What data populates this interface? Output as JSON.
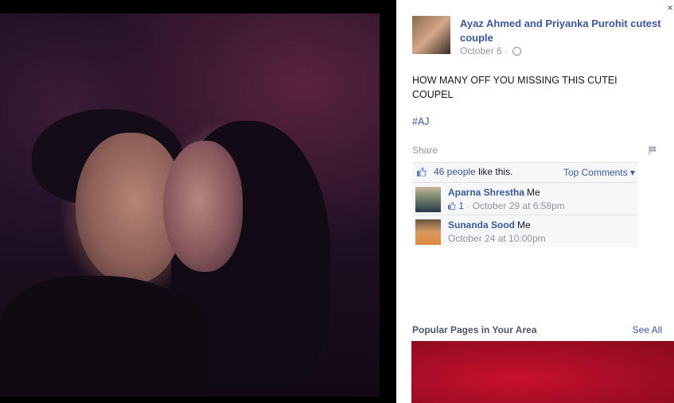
{
  "post": {
    "author": "Ayaz Ahmed and Priyanka Purohit cutest couple",
    "date": "October 6",
    "date_separator": "·",
    "text": "HOW MANY OFF YOU MISSING THIS CUTEI COUPEL",
    "hashtag": "#AJ",
    "share_label": "Share"
  },
  "likes": {
    "count_text": "46 people",
    "suffix": "like this.",
    "top_comments_label": "Top Comments ▾"
  },
  "comments": [
    {
      "name": "Aparna Shrestha",
      "text": "Me",
      "like_count": "1",
      "time": "· October 29 at 6:58pm"
    },
    {
      "name": "Sunanda Sood",
      "text": "Me",
      "time": "October 24 at 10:00pm"
    }
  ],
  "sidebar": {
    "popular_label": "Popular Pages in Your Area",
    "see_all_label": "See All",
    "close_glyph": "×"
  },
  "icons": [
    "globe-icon",
    "like-thumb-icon",
    "flag-icon",
    "close-icon"
  ],
  "colors": {
    "link": "#3b5998",
    "meta": "#90949c",
    "ad_red": "#c8102e"
  }
}
